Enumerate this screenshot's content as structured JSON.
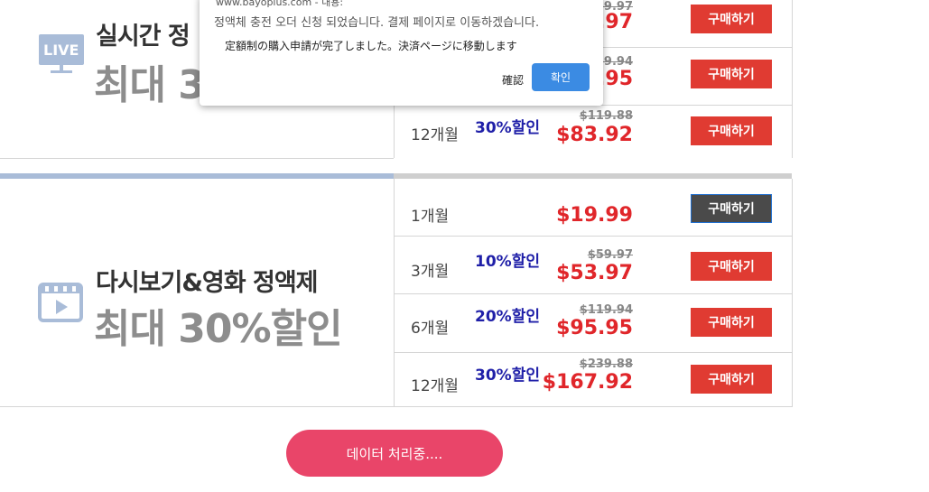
{
  "dialog": {
    "url": "www.bayoplus.com - 내용:",
    "message_ko": "정액체 충전 오더 신청 되었습니다. 결제 페이지로 이동하겠습니다.",
    "message_ja": "定額制の購入申請が完了しました。決済ページに移動します",
    "confirm_ja": "確認",
    "confirm_label": "확인"
  },
  "live_section": {
    "icon": "live-tv-icon",
    "icon_text": "LIVE",
    "title": "실시간 정",
    "subtitle": "최대 3",
    "rows": [
      {
        "period": "",
        "discount": "",
        "original": "$29.97",
        "price": "$.97",
        "buy": "구매하기"
      },
      {
        "period": "",
        "discount": "",
        "original": "$59.94",
        "price": "$.95",
        "buy": "구매하기"
      },
      {
        "period": "12개월",
        "discount": "30%할인",
        "original": "$119.88",
        "price": "$83.92",
        "buy": "구매하기"
      }
    ]
  },
  "vod_section": {
    "icon": "video-play-icon",
    "title": "다시보기&영화 정액제",
    "subtitle": "최대 30%할인",
    "rows": [
      {
        "period": "1개월",
        "discount": "",
        "original": "",
        "price": "$19.99",
        "buy": "구매하기"
      },
      {
        "period": "3개월",
        "discount": "10%할인",
        "original": "$59.97",
        "price": "$53.97",
        "buy": "구매하기"
      },
      {
        "period": "6개월",
        "discount": "20%할인",
        "original": "$119.94",
        "price": "$95.95",
        "buy": "구매하기"
      },
      {
        "period": "12개월",
        "discount": "30%할인",
        "original": "$239.88",
        "price": "$167.92",
        "buy": "구매하기"
      }
    ]
  },
  "processing_button": "데이터 처리중....",
  "colors": {
    "accent_red": "#e0262a",
    "discount_blue": "#1f1fa8",
    "processing_pink": "#e94569",
    "section_bar": "#a9bcd8"
  }
}
